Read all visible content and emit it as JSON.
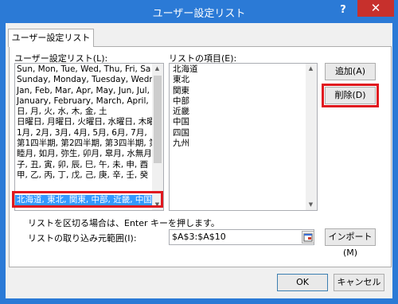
{
  "window": {
    "title": "ユーザー設定リスト",
    "help_glyph": "?",
    "close_glyph": "✕"
  },
  "tab": {
    "label": "ユーザー設定リスト"
  },
  "custom_lists": {
    "label": "ユーザー設定リスト(L):",
    "items": [
      "Sun, Mon, Tue, Wed, Thu, Fri, Sa",
      "Sunday, Monday, Tuesday, Wedr",
      "Jan, Feb, Mar, Apr, May, Jun, Jul,",
      "January, February, March, April, I",
      "日, 月, 火, 水, 木, 金, 土",
      "日曜日, 月曜日, 火曜日, 水曜日, 木曜",
      "1月, 2月, 3月, 4月, 5月, 6月, 7月,",
      "第1四半期, 第2四半期, 第3四半期, 第",
      "睦月, 如月, 弥生, 卯月, 皐月, 水無月",
      "子, 丑, 寅, 卯, 辰, 巳, 午, 未, 申, 酉",
      "甲, 乙, 丙, 丁, 戊, 己, 庚, 辛, 壬, 癸"
    ],
    "selected_item": "北海道, 東北, 関東, 中部, 近畿, 中国"
  },
  "list_entries": {
    "label": "リストの項目(E):",
    "items": [
      "北海道",
      "東北",
      "関東",
      "中部",
      "近畿",
      "中国",
      "四国",
      "九州"
    ]
  },
  "buttons": {
    "add": "追加(A)",
    "delete": "削除(D)",
    "import": "インポート(M)",
    "ok": "OK",
    "cancel": "キャンセル"
  },
  "hint_text": "リストを区切る場合は、Enter キーを押します。",
  "import_range": {
    "label": "リストの取り込み元範囲(I):",
    "value": "$A$3:$A$10"
  },
  "colors": {
    "titlebar": "#2b7ad6",
    "close": "#c7302c",
    "selection": "#3399ff",
    "highlight_frame": "#e0181f"
  }
}
